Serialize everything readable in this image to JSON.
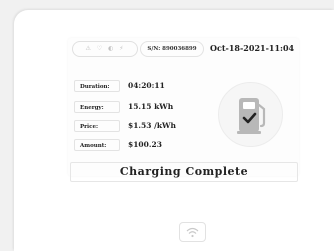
{
  "header": {
    "status_icons": [
      "⚠",
      "♡",
      "◐",
      "⚡"
    ],
    "serial": "S/N: 890036899",
    "datetime": "Oct-18-2021-11:04"
  },
  "session": {
    "rows": [
      {
        "label": "Duration:",
        "value": "04:20:11"
      },
      {
        "label": "Energy:",
        "value": "15.15 kWh"
      },
      {
        "label": "Price:",
        "value": "$1.53 /kWh"
      },
      {
        "label": "Amount:",
        "value": "$100.23"
      }
    ]
  },
  "status": {
    "message": "Charging Complete",
    "icon": "fuel-pump-check-icon"
  },
  "footer": {
    "icon": "wifi-icon"
  }
}
